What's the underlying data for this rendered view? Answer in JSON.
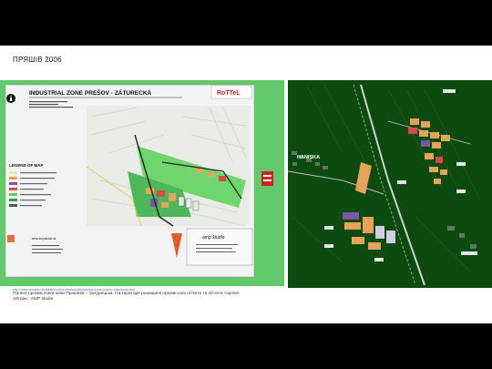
{
  "slide": {
    "title": "ПРЯШІВ 2006",
    "caption_url": "http://www.archinfo.sk/diela/verejna-stavba/priemyselna-zona-presov-zaturecka.html",
    "caption_text": "Проект промислової зони Пряшева – Затурецька. На території розміщені промислові об’єкти та об’єкти торгівлі.",
    "caption_author": "Автори : AMP studio"
  },
  "left_map": {
    "header": "INDUSTRIAL ZONE  PREŠOV - ZÁTURECKÁ",
    "rottel_logo": "RoTTeL",
    "legend_title": "LEGEND OF MAP",
    "studio_name": "amp štúdio",
    "website": "www.ampstudio.sk"
  },
  "right_map": {
    "area_label": "HANISKA"
  },
  "colors": {
    "background": "#000000",
    "slide": "#ffffff",
    "left_map_green": "#62c96a",
    "right_map_green": "#0d4a0f",
    "building_orange": "#e8a35a",
    "header_bg": "#f3f3f3"
  }
}
